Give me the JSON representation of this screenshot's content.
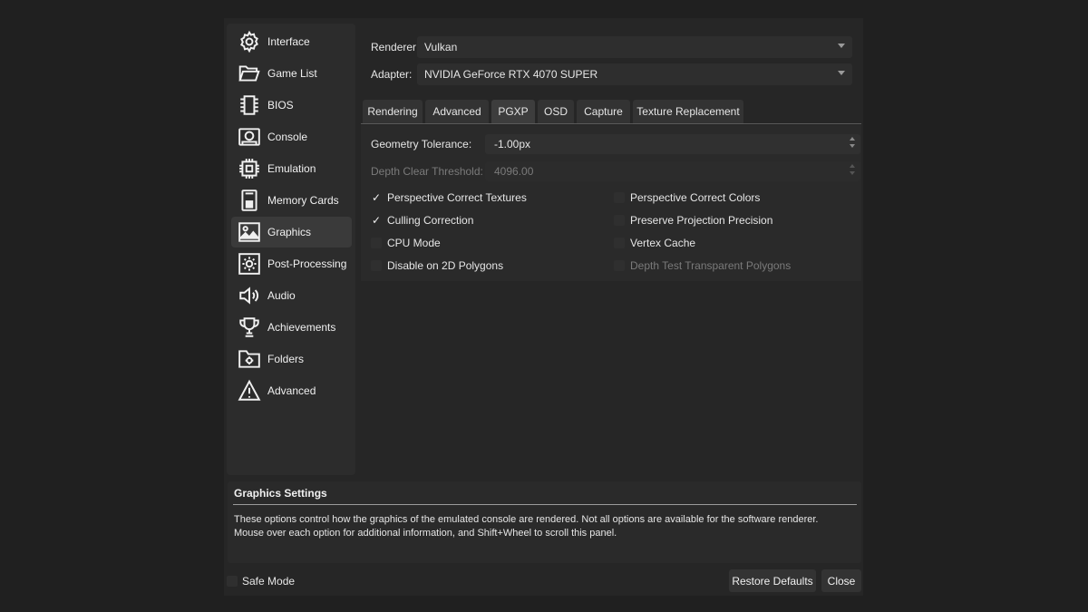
{
  "sidebar": {
    "items": [
      {
        "label": "Interface",
        "icon": "gear-icon"
      },
      {
        "label": "Game List",
        "icon": "folder-open-icon"
      },
      {
        "label": "BIOS",
        "icon": "chip-icon"
      },
      {
        "label": "Console",
        "icon": "console-icon"
      },
      {
        "label": "Emulation",
        "icon": "cpu-icon"
      },
      {
        "label": "Memory Cards",
        "icon": "memory-card-icon"
      },
      {
        "label": "Graphics",
        "icon": "image-icon"
      },
      {
        "label": "Post-Processing",
        "icon": "brightness-icon"
      },
      {
        "label": "Audio",
        "icon": "speaker-icon"
      },
      {
        "label": "Achievements",
        "icon": "trophy-icon"
      },
      {
        "label": "Folders",
        "icon": "folder-gear-icon"
      },
      {
        "label": "Advanced",
        "icon": "warning-icon"
      }
    ],
    "selected": "Graphics"
  },
  "renderer": {
    "label": "Renderer:",
    "value": "Vulkan"
  },
  "adapter": {
    "label": "Adapter:",
    "value": "NVIDIA GeForce RTX 4070 SUPER"
  },
  "tabs": [
    "Rendering",
    "Advanced",
    "PGXP",
    "OSD",
    "Capture",
    "Texture Replacement"
  ],
  "active_tab": "PGXP",
  "pgxp": {
    "geometry_tolerance": {
      "label": "Geometry Tolerance:",
      "value": "-1.00px"
    },
    "depth_clear_threshold": {
      "label": "Depth Clear Threshold:",
      "value": "4096.00"
    },
    "checkboxes_left": [
      {
        "label": "Perspective Correct Textures",
        "checked": true
      },
      {
        "label": "Culling Correction",
        "checked": true
      },
      {
        "label": "CPU Mode",
        "checked": false
      },
      {
        "label": "Disable on 2D Polygons",
        "checked": false
      }
    ],
    "checkboxes_right": [
      {
        "label": "Perspective Correct Colors",
        "checked": false
      },
      {
        "label": "Preserve Projection Precision",
        "checked": false
      },
      {
        "label": "Vertex Cache",
        "checked": false
      },
      {
        "label": "Depth Test Transparent Polygons",
        "checked": false
      }
    ]
  },
  "info": {
    "title": "Graphics Settings",
    "description": "These options control how the graphics of the emulated console are rendered. Not all options are available for the software renderer. Mouse over each option for additional information, and Shift+Wheel to scroll this panel."
  },
  "footer": {
    "safe_mode": "Safe Mode",
    "restore_defaults": "Restore Defaults",
    "close": "Close"
  },
  "check_mark": "✓"
}
